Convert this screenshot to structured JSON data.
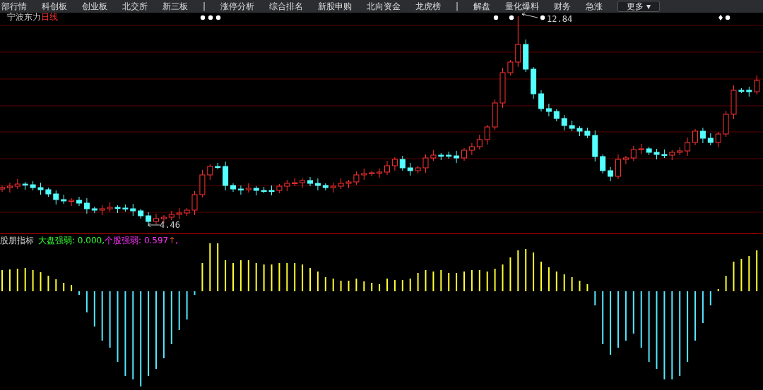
{
  "menu": {
    "items": [
      "部行情",
      "科创板",
      "创业板",
      "北交所",
      "新三板",
      "|",
      "涨停分析",
      "综合排名",
      "新股申购",
      "北向资金",
      "龙虎榜",
      "|",
      "解盘",
      "量化爆料",
      "财务",
      "急涨"
    ],
    "more_button": "更多 ▾"
  },
  "chart": {
    "stock_name": "宁波东力",
    "period": "日线",
    "price_labels": [
      "12.84",
      "4.46"
    ]
  },
  "indicator": {
    "name": "股朋指标",
    "legend": [
      {
        "text": "大盘强弱: 0.000,",
        "color": "#33ff33"
      },
      {
        "text": "个股强弱: 0.597",
        "color": "#ff33ff",
        "arrow": "↑",
        "tail": ","
      }
    ]
  }
}
